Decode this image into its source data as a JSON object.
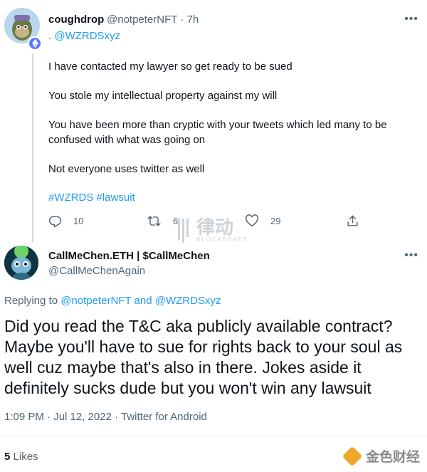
{
  "tweet1": {
    "author_name": "coughdrop",
    "handle": "@notpeterNFT",
    "time": "· 7h",
    "reply_prefix": ".",
    "reply_mention": "@WZRDSxyz",
    "paragraphs": [
      "I have contacted my lawyer so get ready to be sued",
      "You stole my intellectual property against my will",
      "You have been more than cryptic with your tweets which led many to be confused with what was going on",
      "Not everyone uses twitter as well"
    ],
    "hashtags": "#WZRDS #lawsuit",
    "reply_count": "10",
    "retweet_count": "6",
    "like_count": "29"
  },
  "tweet2": {
    "author_name": "CallMeChen.ETH | $CallMeChen",
    "handle": "@CallMeChenAgain",
    "replying_label": "Replying to",
    "replying_to_1": "@notpeterNFT",
    "replying_and": "and",
    "replying_to_2": "@WZRDSxyz",
    "text": "Did you read the T&C aka publicly available contract? Maybe you'll have to sue for rights back to your soul as well cuz maybe that's also in there. Jokes aside it definitely sucks dude but you won't win any lawsuit",
    "timestamp": "1:09 PM · Jul 12, 2022 · Twitter for Android",
    "likes_count": "5",
    "likes_label": "Likes"
  },
  "watermark": {
    "text": "律动",
    "sub": "BLOCKBEATS"
  },
  "logo": {
    "text": "金色财经"
  },
  "icons": {
    "reply": "reply-icon",
    "retweet": "retweet-icon",
    "like": "heart-icon",
    "share": "share-icon",
    "more": "more-icon",
    "verified": "ethereum-badge-icon"
  },
  "colors": {
    "link": "#1d9bf0",
    "secondary": "#536471",
    "logo": "#f0a626"
  }
}
